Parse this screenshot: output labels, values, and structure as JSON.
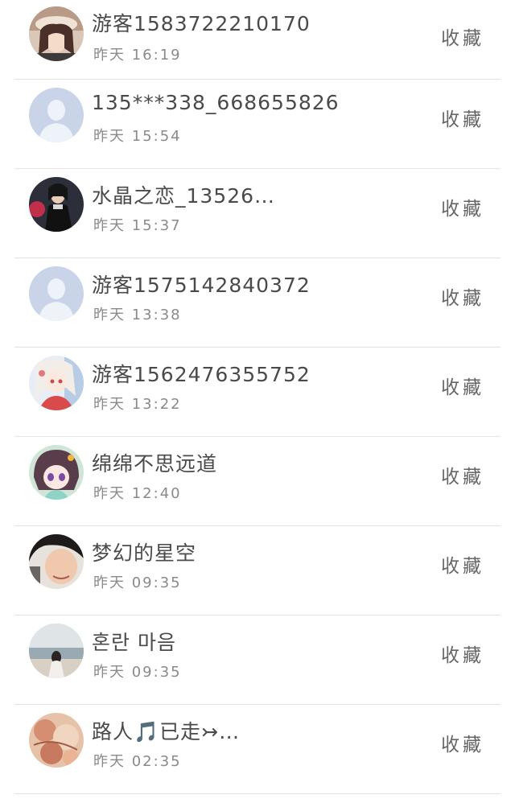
{
  "users": [
    {
      "name": "游客1583722210170",
      "time": "昨天 16:19",
      "action": "收藏",
      "avatar": "girl-photo-avatar"
    },
    {
      "name": "135***338_668655826",
      "time": "昨天 15:54",
      "action": "收藏",
      "avatar": "default-avatar"
    },
    {
      "name": "水晶之恋_13526…",
      "time": "昨天 15:37",
      "action": "收藏",
      "avatar": "person-photo-avatar"
    },
    {
      "name": "游客1575142840372",
      "time": "昨天 13:38",
      "action": "收藏",
      "avatar": "default-avatar"
    },
    {
      "name": "游客1562476355752",
      "time": "昨天 13:22",
      "action": "收藏",
      "avatar": "anime-girl-avatar"
    },
    {
      "name": "绵绵不思远道",
      "time": "昨天 12:40",
      "action": "收藏",
      "avatar": "anime-chibi-avatar"
    },
    {
      "name": "梦幻的星空",
      "time": "昨天 09:35",
      "action": "收藏",
      "avatar": "boy-photo-avatar"
    },
    {
      "name": "혼란 마음",
      "time": "昨天 09:35",
      "action": "收藏",
      "avatar": "seaside-girl-avatar"
    },
    {
      "name": "路人🎵已走↣…",
      "time": "昨天 02:35",
      "action": "收藏",
      "avatar": "flower-photo-avatar"
    }
  ],
  "colors": {
    "default_avatar_bg": "#c9d4e8",
    "default_avatar_fg": "#eef2f9",
    "divider": "#e3e3e3"
  }
}
